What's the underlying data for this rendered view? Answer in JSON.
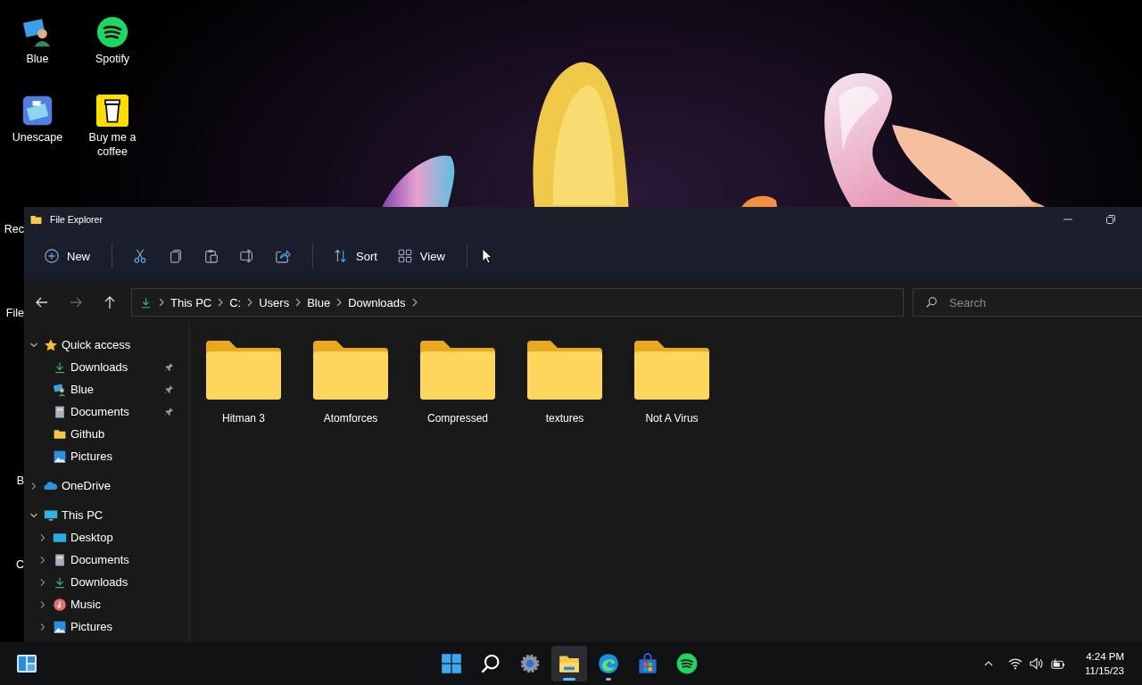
{
  "desktop": {
    "icons": [
      {
        "label": "Blue",
        "kind": "user"
      },
      {
        "label": "Spotify",
        "kind": "spotify"
      },
      {
        "label": "Unescape",
        "kind": "game"
      },
      {
        "label": "Buy me a coffee",
        "kind": "coffee"
      }
    ],
    "cut_labels": [
      "Rec",
      "File",
      "B",
      "C"
    ]
  },
  "window": {
    "title": "File Explorer"
  },
  "toolbar": {
    "items": [
      {
        "kind": "new",
        "label": "New"
      },
      {
        "kind": "separator"
      },
      {
        "kind": "cut"
      },
      {
        "kind": "copy"
      },
      {
        "kind": "paste"
      },
      {
        "kind": "rename"
      },
      {
        "kind": "share"
      },
      {
        "kind": "separator"
      },
      {
        "kind": "sort",
        "label": "Sort"
      },
      {
        "kind": "view",
        "label": "View"
      },
      {
        "kind": "separator"
      }
    ]
  },
  "address_bar": {
    "crumbs": [
      "This PC",
      "C:",
      "Users",
      "Blue",
      "Downloads"
    ]
  },
  "search": {
    "placeholder": "Search"
  },
  "sidebar": {
    "items": [
      {
        "label": "Quick access",
        "kind": "star",
        "expanded": true,
        "children": [
          {
            "label": "Downloads",
            "kind": "download",
            "pinned": true
          },
          {
            "label": "Blue",
            "kind": "user",
            "pinned": true
          },
          {
            "label": "Documents",
            "kind": "docs",
            "pinned": true
          },
          {
            "label": "Github",
            "kind": "folder",
            "pinned": false
          },
          {
            "label": "Pictures",
            "kind": "pictures",
            "pinned": false
          }
        ]
      },
      {
        "label": "OneDrive",
        "kind": "cloud",
        "expanded": false
      },
      {
        "label": "This PC",
        "kind": "pc",
        "expanded": true,
        "children": [
          {
            "label": "Desktop",
            "kind": "desktop",
            "expanded": false
          },
          {
            "label": "Documents",
            "kind": "docs",
            "expanded": false
          },
          {
            "label": "Downloads",
            "kind": "download",
            "expanded": false
          },
          {
            "label": "Music",
            "kind": "music",
            "expanded": false
          },
          {
            "label": "Pictures",
            "kind": "pictures",
            "expanded": false
          }
        ]
      }
    ]
  },
  "folders": [
    {
      "name": "Hitman 3"
    },
    {
      "name": "Atomforces"
    },
    {
      "name": "Compressed"
    },
    {
      "name": "textures"
    },
    {
      "name": "Not A Virus"
    }
  ],
  "taskbar": {
    "apps": [
      {
        "kind": "start",
        "active": false,
        "running": false
      },
      {
        "kind": "search",
        "active": false,
        "running": false
      },
      {
        "kind": "settings",
        "active": false,
        "running": false
      },
      {
        "kind": "explorer",
        "active": true,
        "running": true
      },
      {
        "kind": "edge",
        "active": false,
        "running": true
      },
      {
        "kind": "store",
        "active": false,
        "running": false
      },
      {
        "kind": "spotify",
        "active": false,
        "running": false
      }
    ],
    "clock": {
      "time": "4:24 PM",
      "date": "11/15/23"
    }
  }
}
